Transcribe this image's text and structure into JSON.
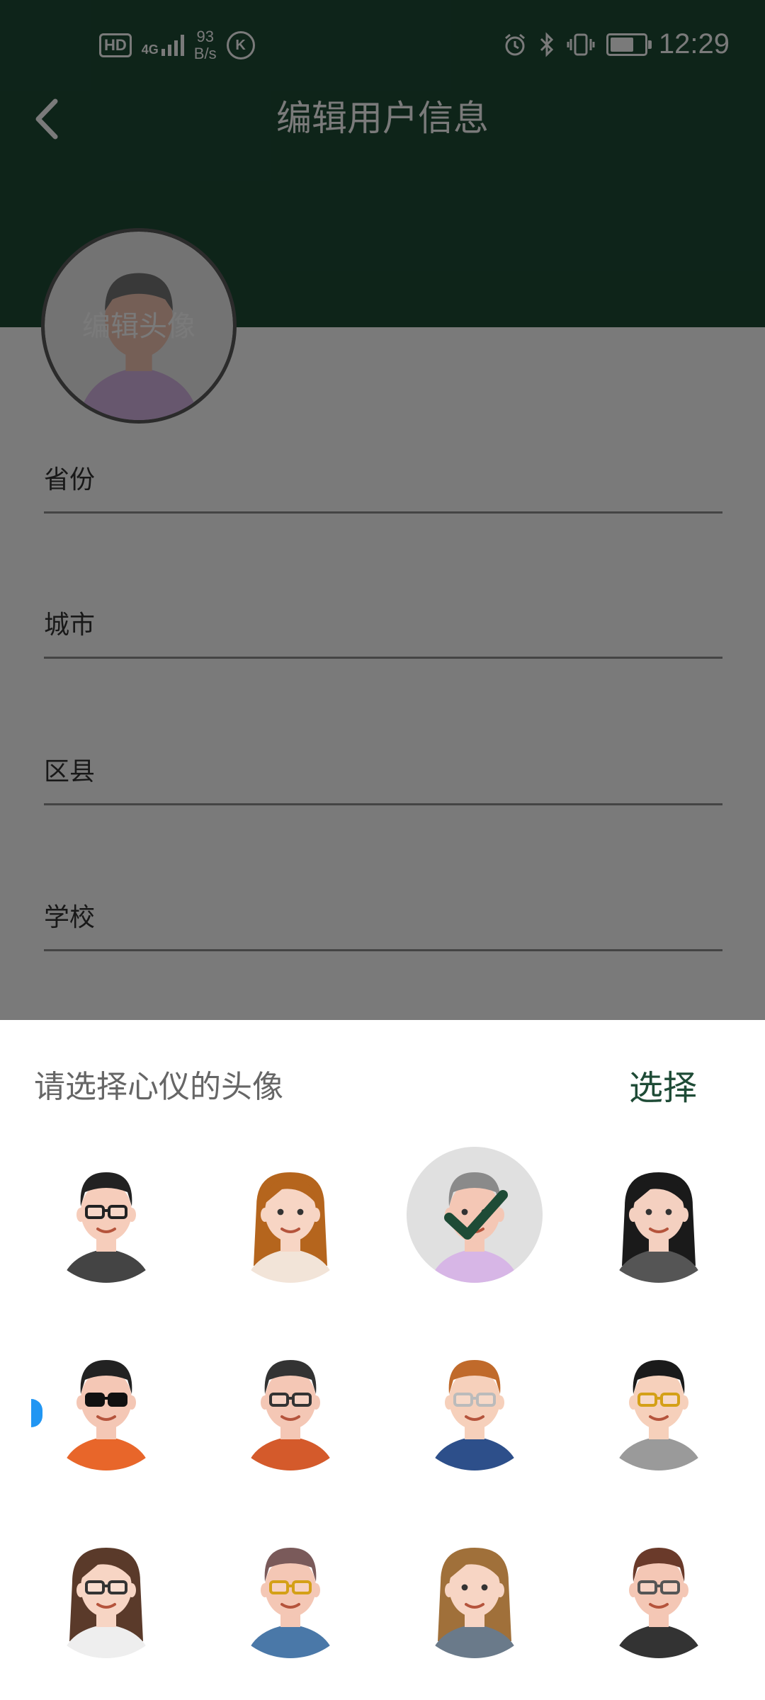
{
  "status_bar": {
    "network": "4G",
    "speed_value": "93",
    "speed_unit": "B/s",
    "hd_label": "HD",
    "k_label": "K",
    "time": "12:29",
    "battery_level": 0.7,
    "icons": [
      "alarm-icon",
      "bluetooth-icon",
      "vibrate-icon",
      "battery-icon"
    ]
  },
  "header": {
    "title": "编辑用户信息",
    "back_icon": "chevron-left-icon",
    "color": "#1e4b36"
  },
  "profile": {
    "avatar_label": "编辑头像"
  },
  "fields": [
    {
      "label": "省份"
    },
    {
      "label": "城市"
    },
    {
      "label": "区县"
    },
    {
      "label": "学校"
    }
  ],
  "avatar_sheet": {
    "title": "请选择心仪的头像",
    "select_label": "选择",
    "selected_index": 2,
    "avatars": [
      "avatar-man-glasses-black-hair",
      "avatar-woman-long-brown-hair",
      "avatar-man-gray-hair-selected",
      "avatar-woman-long-black-hair",
      "avatar-man-sunglasses",
      "avatar-man-glasses-beard",
      "avatar-man-orange-hair-glasses",
      "avatar-man-gold-glasses",
      "avatar-woman-glasses-striped",
      "avatar-man-gold-glasses-denim",
      "avatar-woman-long-hair-smile",
      "avatar-man-glasses-violin"
    ]
  }
}
